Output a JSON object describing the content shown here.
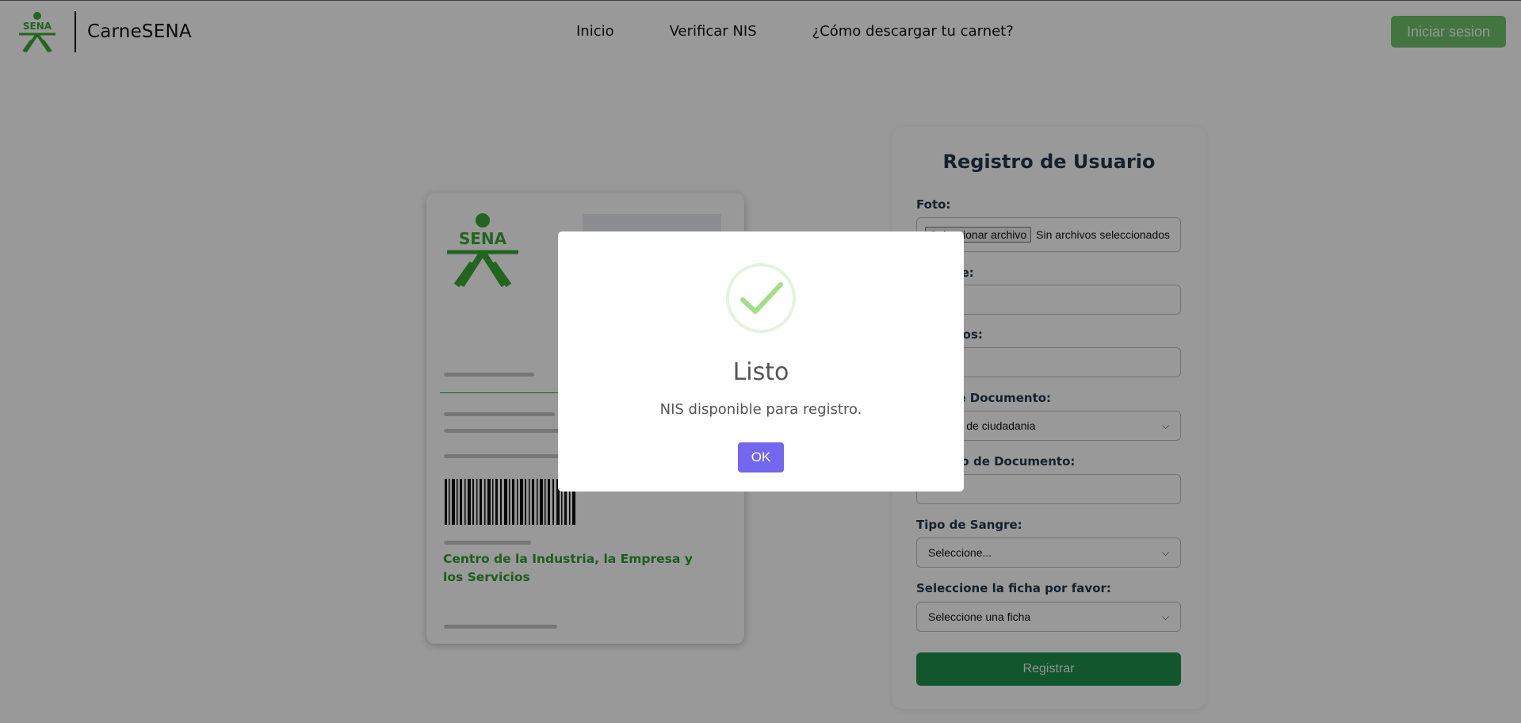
{
  "navbar": {
    "brand_name": "CarneSENA",
    "logo_text": "SENA",
    "links": [
      "Inicio",
      "Verificar NIS",
      "¿Cómo descargar tu carnet?"
    ],
    "login_label": "Iniciar sesion"
  },
  "card": {
    "logo_text": "SENA",
    "center_name": "Centro de la Industria, la Empresa y los Servicios"
  },
  "form": {
    "title": "Registro de Usuario",
    "foto_label": "Foto:",
    "file_button": "Seleccionar archivo",
    "file_text": "Sin archivos seleccionados",
    "nombre_label": "Nombre:",
    "apellidos_label": "Apellidos:",
    "tipo_doc_label": "Tipo de Documento:",
    "tipo_doc_value": "Cédula de ciudadania",
    "num_doc_label": "Número de Documento:",
    "sangre_label": "Tipo de Sangre:",
    "sangre_value": "Seleccione...",
    "ficha_label": "Seleccione la ficha por favor:",
    "ficha_value": "Seleccione una ficha",
    "submit_label": "Registrar"
  },
  "modal": {
    "title": "Listo",
    "text": "NIS disponible para registro.",
    "ok_label": "OK"
  },
  "colors": {
    "brand_green": "#39a935",
    "success_green": "#a5dc86",
    "ok_button": "#7367f0",
    "register_button": "#1f8f4c"
  }
}
